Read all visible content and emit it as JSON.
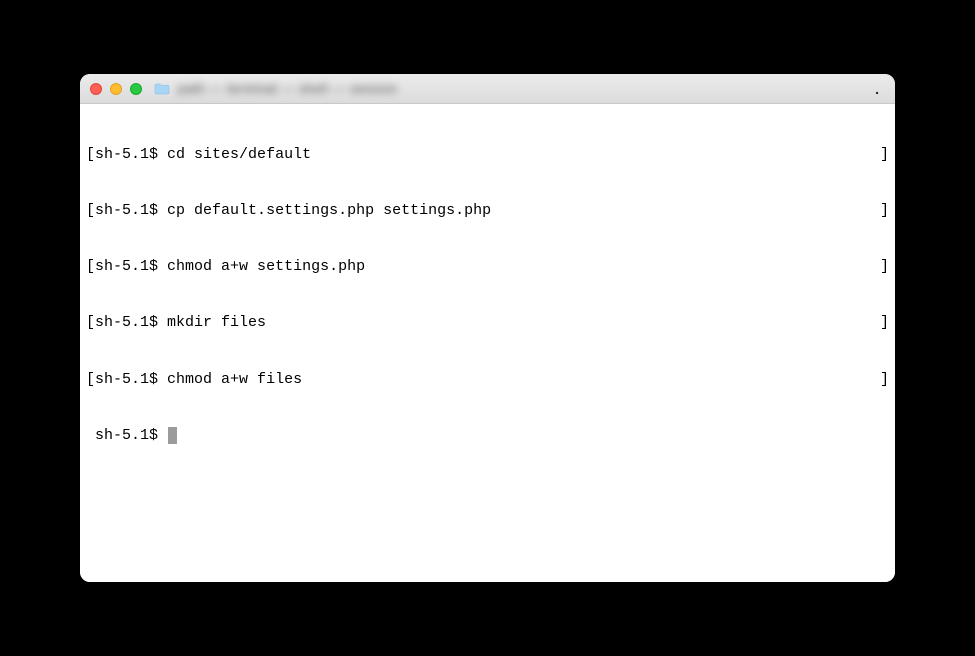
{
  "titlebar": {
    "title_obscured": "path — terminal — shell — session",
    "trailing_dot": "."
  },
  "terminal": {
    "prompt": "sh-5.1$",
    "left_bracket": "[",
    "right_bracket": "]",
    "lines": [
      {
        "command": "cd sites/default"
      },
      {
        "command": "cp default.settings.php settings.php"
      },
      {
        "command": "chmod a+w settings.php"
      },
      {
        "command": "mkdir files"
      },
      {
        "command": "chmod a+w files"
      }
    ],
    "current_prompt": "sh-5.1$ "
  }
}
